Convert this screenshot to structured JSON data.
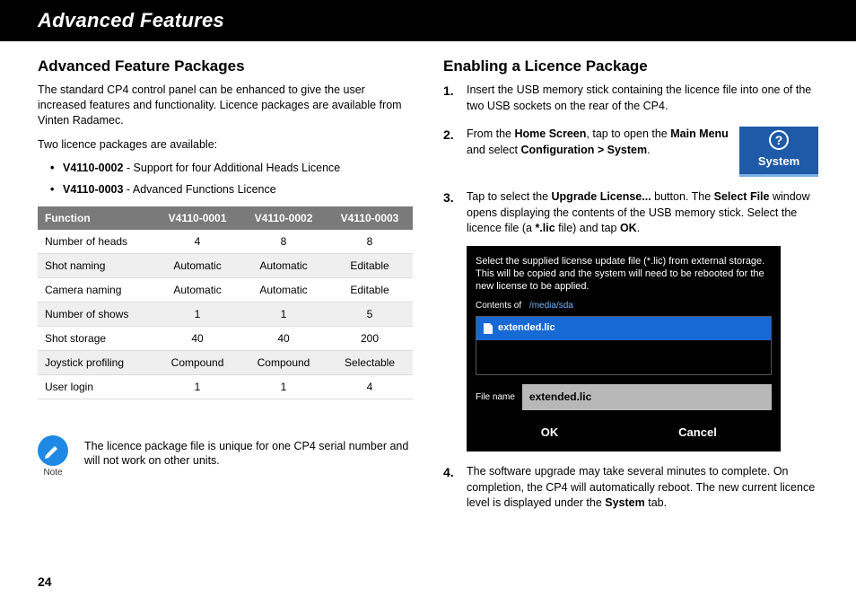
{
  "banner": "Advanced Features",
  "left": {
    "heading": "Advanced Feature Packages",
    "intro": "The standard CP4 control panel can be enhanced to give the user increased features and functionality. Licence packages are available from Vinten Radamec.",
    "avail": "Two licence packages are available:",
    "b1_code": "V4110-0002",
    "b1_rest": " - Support for four Additional Heads Licence",
    "b2_code": "V4110-0003",
    "b2_rest": " - Advanced Functions Licence",
    "table": {
      "h0": "Function",
      "h1": "V4110-0001",
      "h2": "V4110-0002",
      "h3": "V4110-0003",
      "rows": [
        [
          "Number of heads",
          "4",
          "8",
          "8"
        ],
        [
          "Shot naming",
          "Automatic",
          "Automatic",
          "Editable"
        ],
        [
          "Camera naming",
          "Automatic",
          "Automatic",
          "Editable"
        ],
        [
          "Number of shows",
          "1",
          "1",
          "5"
        ],
        [
          "Shot storage",
          "40",
          "40",
          "200"
        ],
        [
          "Joystick profiling",
          "Compound",
          "Compound",
          "Selectable"
        ],
        [
          "User login",
          "1",
          "1",
          "4"
        ]
      ]
    },
    "note_label": "Note",
    "note_text": "The licence package file is unique for one CP4 serial number and will not work on other units."
  },
  "right": {
    "heading": "Enabling a Licence Package",
    "s1": "Insert the USB memory stick containing the licence file into one of the two USB sockets on the rear of the CP4.",
    "s2_pre": "From the ",
    "s2_home": "Home Screen",
    "s2_mid": ", tap to open the ",
    "s2_menu": "Main Menu",
    "s2_mid2": " and select ",
    "s2_conf": "Configuration > System",
    "s2_end": ".",
    "sys_btn_label": "System",
    "s3_pre": "Tap to select the ",
    "s3_btn": "Upgrade License...",
    "s3_mid": " button. The ",
    "s3_win": "Select File",
    "s3_mid2": " window opens displaying the contents of the USB memory stick. Select the licence file (a ",
    "s3_ext": "*.lic",
    "s3_mid3": " file) and tap ",
    "s3_ok": "OK",
    "s3_end": ".",
    "dialog": {
      "instr": "Select the supplied license update file (*.lic) from external storage. This will be copied and the system will need to be rebooted for the new license to be applied.",
      "contents_label": "Contents of",
      "path": "/media/sda",
      "file": "extended.lic",
      "filename_label": "File name",
      "filename_value": "extended.lic",
      "ok": "OK",
      "cancel": "Cancel"
    },
    "s4_pre": "The software upgrade may take several minutes to complete. On completion, the CP4 will automatically reboot. The new current licence level is displayed under the ",
    "s4_sys": "System",
    "s4_end": " tab."
  },
  "pagenum": "24"
}
